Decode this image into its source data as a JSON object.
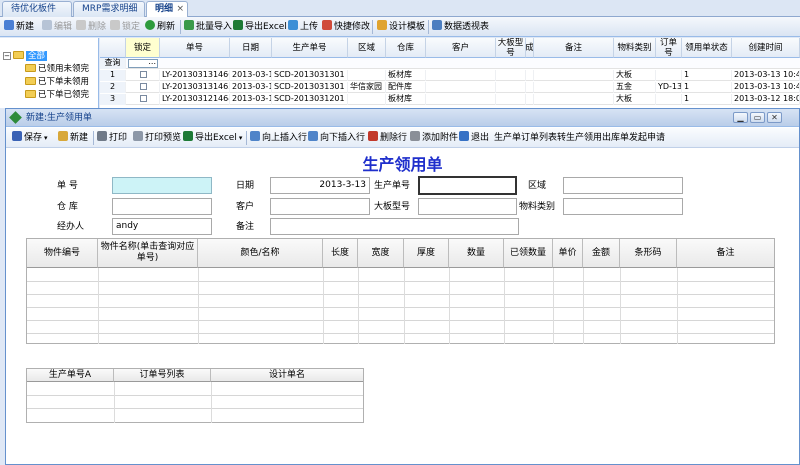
{
  "tabs": [
    {
      "label": "待优化板件",
      "close": ""
    },
    {
      "label": "MRP需求明细",
      "close": ""
    },
    {
      "label": "明细",
      "close": "×"
    }
  ],
  "bg_toolbar": {
    "new": "新建",
    "edit": "编辑",
    "delete": "删除",
    "lock": "锁定",
    "refresh": "刷新",
    "import": "批量导入",
    "export": "导出Excel",
    "upload": "上传",
    "quick_edit": "快捷修改",
    "design": "设计模板",
    "pivot": "数据透视表"
  },
  "tree": {
    "root": "全部",
    "children": [
      "已领用未领完",
      "已下单未领用",
      "已下单已领完"
    ]
  },
  "grid": {
    "columns": [
      "锁定",
      "单号",
      "日期",
      "生产单号",
      "区域",
      "仓库",
      "客户",
      "大板型号",
      "成",
      "备注",
      "物料类别",
      "订单号",
      "领用单状态",
      "创建时间"
    ],
    "query_label": "查询",
    "query_ellipsis": "...",
    "rows": [
      {
        "num": "1",
        "no": "LY-201303131466",
        "date": "2013-03-13",
        "prod": "SCD-201303130​1",
        "area": "",
        "wh": "板材库",
        "cust": "",
        "model": "",
        "c": "",
        "remark": "",
        "cat": "大板",
        "order": "",
        "status": "1",
        "created": "2013-03-13 10:42:1"
      },
      {
        "num": "2",
        "no": "LY-201303131465",
        "date": "2013-03-13",
        "prod": "SCD-201303130​1",
        "area": "华信家园",
        "wh": "配件库",
        "cust": "",
        "model": "",
        "c": "",
        "remark": "",
        "cat": "五金",
        "order": "YD-130",
        "status": "1",
        "created": "2013-03-13 10:42:1"
      },
      {
        "num": "3",
        "no": "LY-201303121464",
        "date": "2013-03-12",
        "prod": "SCD-201303120​1",
        "area": "",
        "wh": "板材库",
        "cust": "",
        "model": "",
        "c": "",
        "remark": "",
        "cat": "大板",
        "order": "",
        "status": "1",
        "created": "2013-03-12 18:05:0"
      }
    ]
  },
  "dialog": {
    "title": "新建:生产领用单",
    "win_min": "▁",
    "win_max": "▭",
    "win_close": "✕",
    "toolbar": {
      "save": "保存",
      "new": "新建",
      "print": "打印",
      "preview": "打印预览",
      "export": "导出Excel",
      "insert_up": "向上插入行",
      "insert_down": "向下插入行",
      "delete_row": "删除行",
      "attach": "添加附件",
      "exit": "退出",
      "prod_orders": "生产单订单列表",
      "to_outbound": "转生产领用出库单",
      "request": "发起申请"
    },
    "form_title": "生产领用单",
    "fields": {
      "no_label": "单    号",
      "date_label": "日期",
      "date_value": "2013-3-13",
      "prod_label": "生产单号",
      "area_label": "区域",
      "wh_label": "仓    库",
      "cust_label": "客户",
      "model_label": "大板型号",
      "cat_label": "物料类别",
      "handler_label": "经办人",
      "handler_value": "andy",
      "remark_label": "备注"
    },
    "detail_columns": [
      "物件编号",
      "物件名称(单击查询对应单号)",
      "颜色/名称",
      "长度",
      "宽度",
      "厚度",
      "数量",
      "已领数量",
      "单价",
      "金额",
      "条形码",
      "备注"
    ],
    "sub_columns": [
      "生产单号A",
      "订单号列表",
      "设计单名"
    ]
  }
}
